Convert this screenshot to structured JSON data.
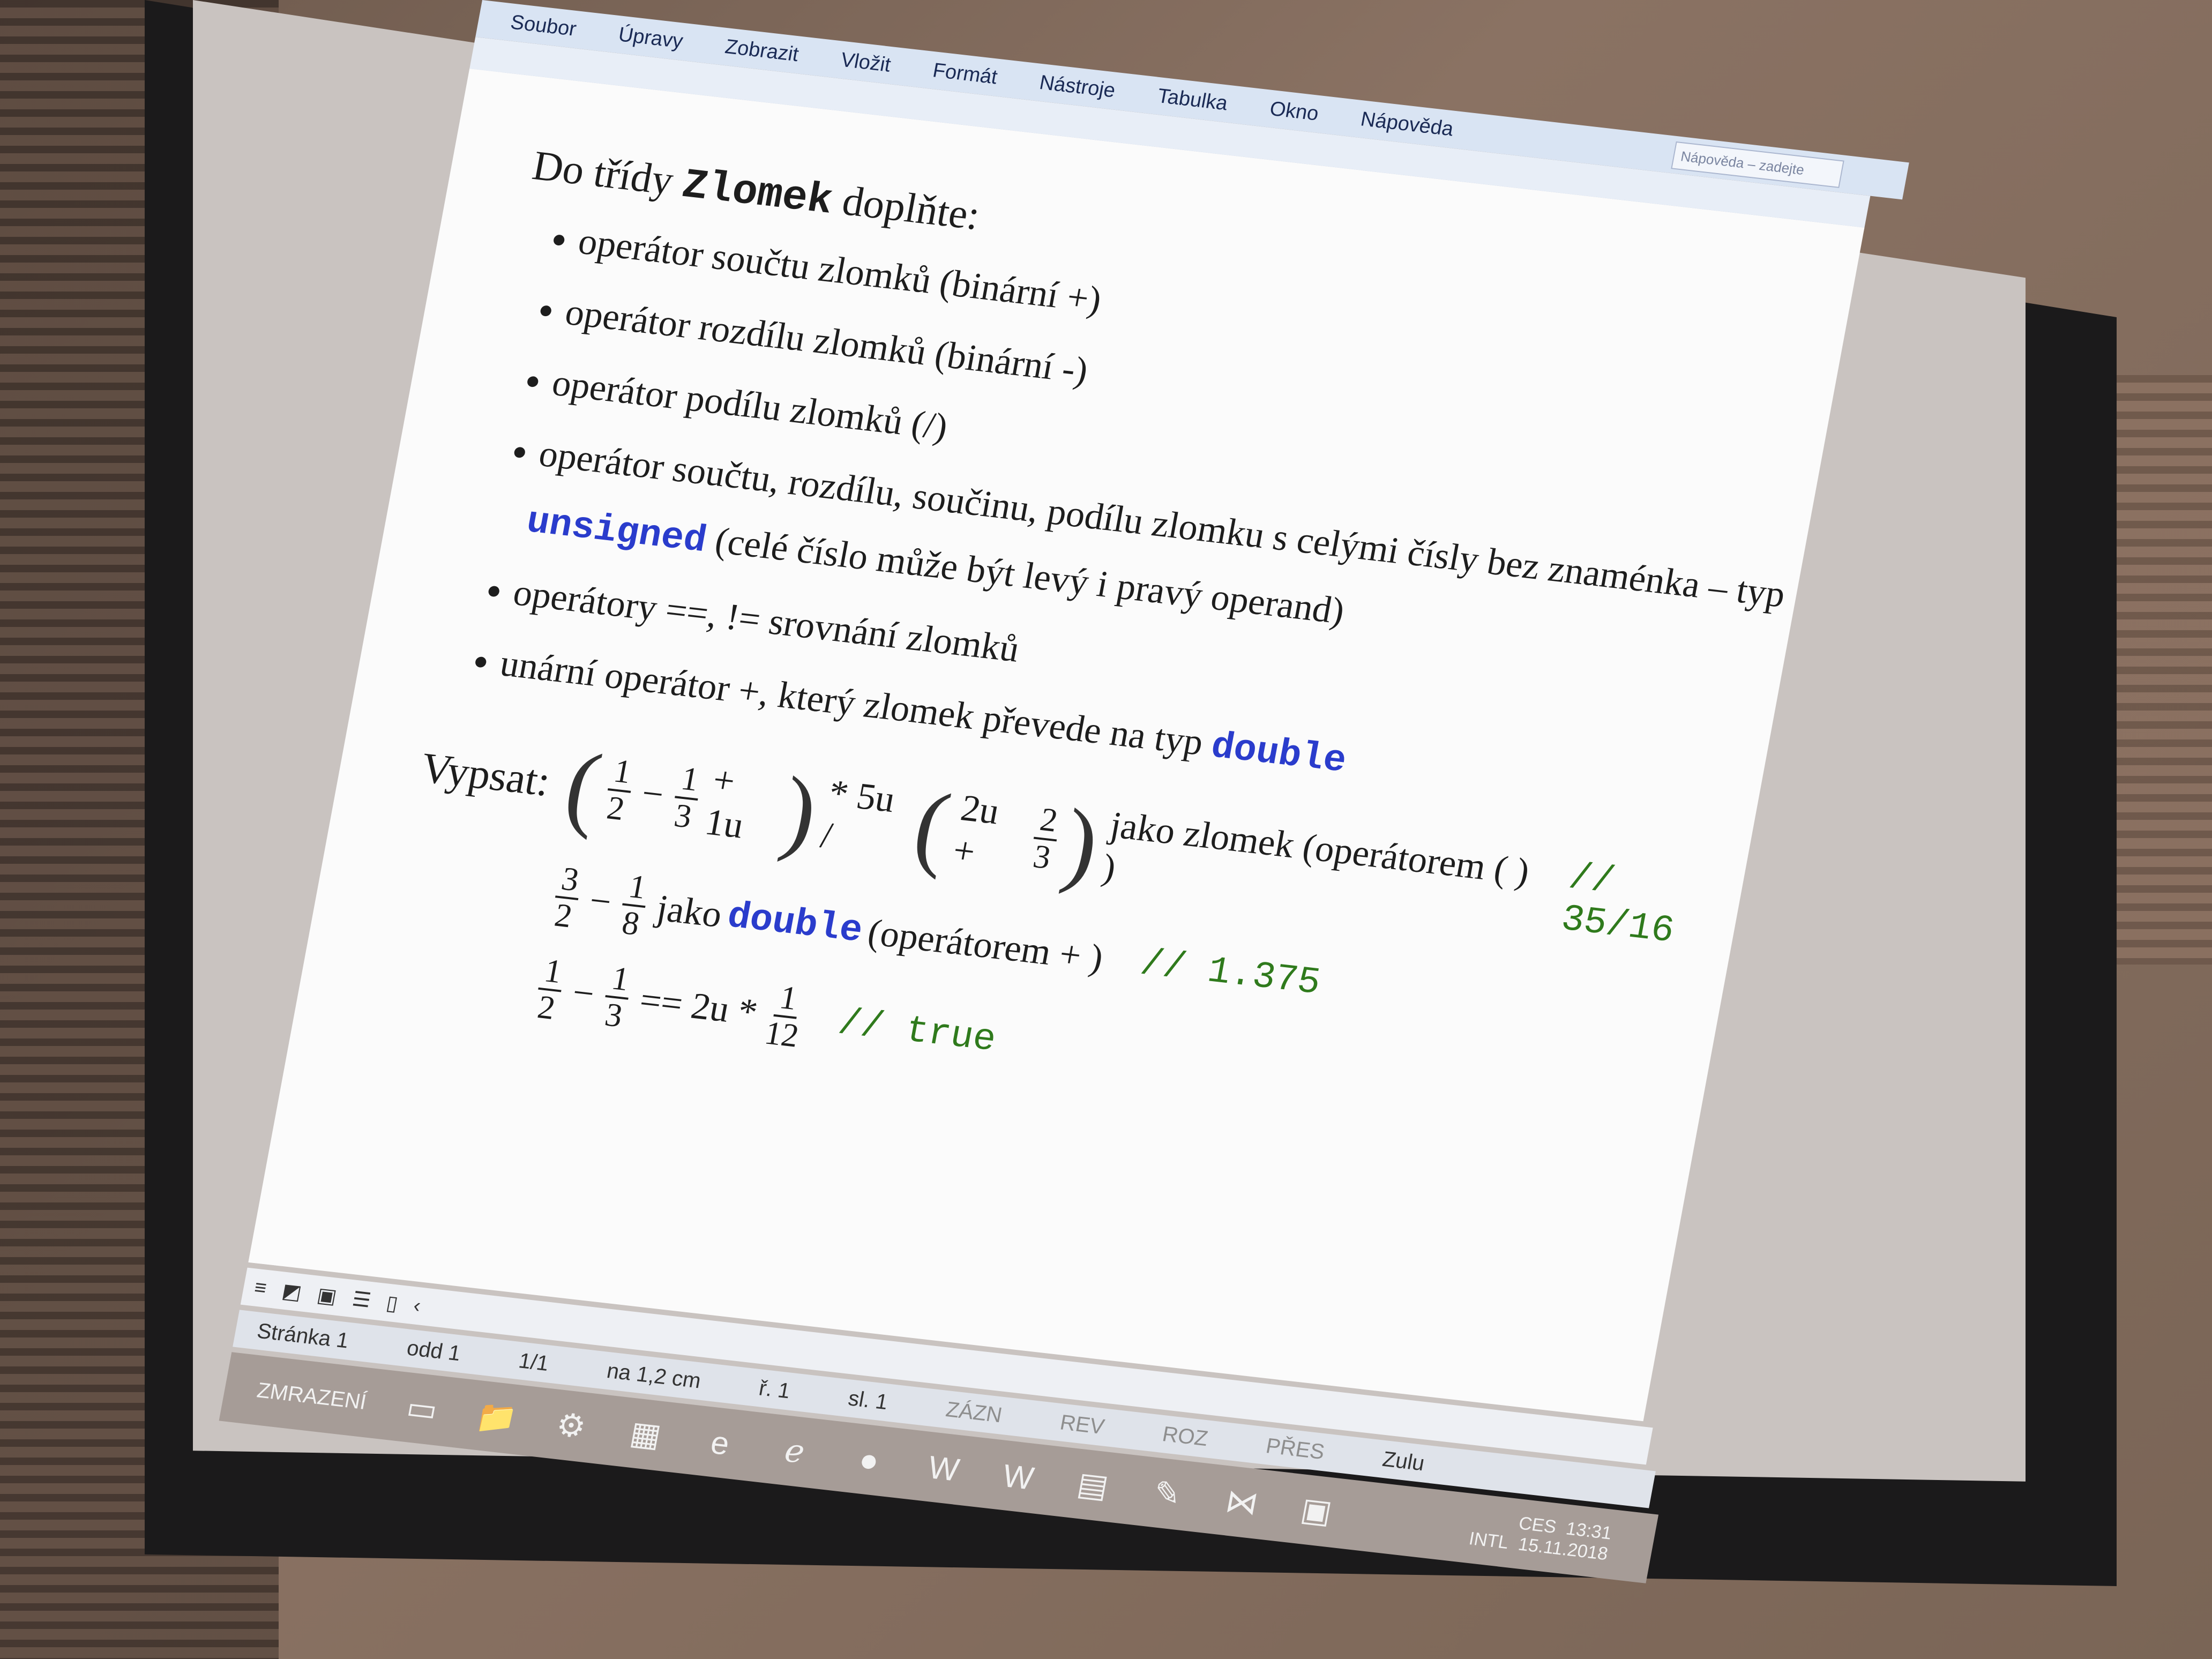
{
  "menu": [
    "Soubor",
    "Úpravy",
    "Zobrazit",
    "Vložit",
    "Formát",
    "Nástroje",
    "Tabulka",
    "Okno",
    "Nápověda"
  ],
  "help_box": "Nápověda – zadejte dotaz",
  "heading_pre": "Do třídy ",
  "heading_class": "Zlomek",
  "heading_post": " doplňte:",
  "bullets": {
    "b1": "operátor součtu zlomků (binární +)",
    "b2": "operátor rozdílu zlomků (binární -)",
    "b3": "operátor podílu zlomků (/)",
    "b4_pre": "operátor součtu, rozdílu, součinu, podílu zlomku s celými čísly bez znaménka – typ ",
    "b4_kw": "unsigned",
    "b4_post": " (celé číslo může být levý i pravý operand)",
    "b5": "operátory ==, != srovnání zlomků",
    "b6_pre": "unární operátor +, který zlomek převede na typ ",
    "b6_kw": "double"
  },
  "vypsat_label": "Vypsat:",
  "line1": {
    "f1n": "1",
    "f1d": "2",
    "f2n": "1",
    "f2d": "3",
    "plus_1u": "+ 1u",
    "times": "* 5u /",
    "two_u_plus": "2u +",
    "f3n": "2",
    "f3d": "3",
    "text": "jako zlomek (operátorem ( ) )",
    "comment": "// 35/16"
  },
  "line2": {
    "f1n": "3",
    "f1d": "2",
    "f2n": "1",
    "f2d": "8",
    "text_pre": "jako ",
    "kw": "double",
    "text_post": " (operátorem + )",
    "comment": "// 1.375"
  },
  "line3": {
    "f1n": "1",
    "f1d": "2",
    "f2n": "1",
    "f2d": "3",
    "mid": "== 2u *",
    "f3n": "1",
    "f3d": "12",
    "comment": "// true"
  },
  "status": {
    "page": "Stránka 1",
    "section": "odd 1",
    "pages": "1/1",
    "at": "na 1,2 cm",
    "row": "ř. 1",
    "col": "sl. 1",
    "modes": [
      "ZÁZN",
      "REV",
      "ROZ",
      "PŘES"
    ],
    "lang": "Zulu"
  },
  "taskbar": {
    "freeze": "ZMRAZENÍ",
    "tray_lang": "CES",
    "tray_layout": "INTL",
    "time": "13:31",
    "date": "15.11.2018"
  }
}
